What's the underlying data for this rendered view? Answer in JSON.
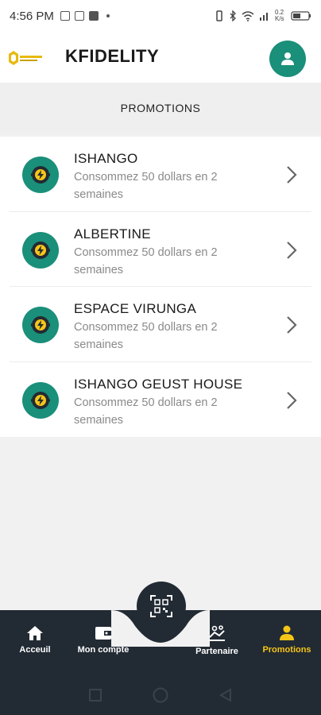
{
  "status_bar": {
    "time": "4:56 PM",
    "network_speed": "0.2 K/s",
    "battery": "40"
  },
  "app_bar": {
    "logo_text": "Kfidelity",
    "title": "KFIDELITY"
  },
  "section": {
    "title": "PROMOTIONS"
  },
  "promotions": [
    {
      "name": "ISHANGO",
      "description": "Consommez 50 dollars en 2 semaines"
    },
    {
      "name": "ALBERTINE",
      "description": "Consommez 50 dollars en 2 semaines"
    },
    {
      "name": "ESPACE VIRUNGA",
      "description": "Consommez 50 dollars en 2 semaines"
    },
    {
      "name": "ISHANGO GEUST HOUSE",
      "description": "Consommez 50 dollars en 2 semaines"
    }
  ],
  "bottom_nav": {
    "items": [
      {
        "label": "Acceuil",
        "icon": "home-icon"
      },
      {
        "label": "Mon compte",
        "icon": "wallet-icon"
      },
      {
        "label": "Partenaire",
        "icon": "partner-icon"
      },
      {
        "label": "Promotions",
        "icon": "person-icon"
      }
    ],
    "active": "Promotions",
    "center_action": "qr-scan-icon"
  },
  "colors": {
    "accent": "#1a8f7a",
    "nav_background": "#222a33",
    "active_nav": "#f5c518"
  }
}
